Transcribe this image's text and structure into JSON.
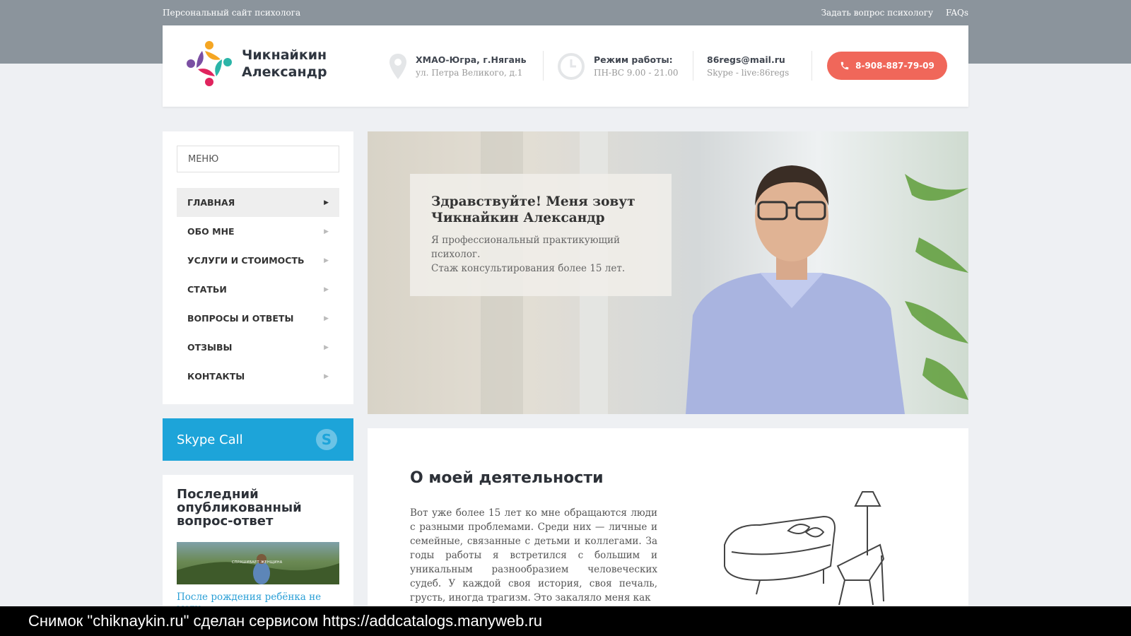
{
  "topbar": {
    "site_tagline": "Персональный сайт психолога",
    "links": [
      "Задать вопрос психологу",
      "FAQs"
    ]
  },
  "header": {
    "logo_line1": "Чикнайкин",
    "logo_line2": "Александр",
    "location": {
      "city": "ХМАО-Югра, г.Нягань",
      "address": "ул. Петра Великого, д.1",
      "icon": "map-pin-icon"
    },
    "hours": {
      "label": "Режим работы:",
      "value": "ПН-ВС 9.00 - 21.00",
      "icon": "clock-icon"
    },
    "contact": {
      "email": "86regs@mail.ru",
      "skype": "Skype - live:86regs"
    },
    "phone": "8-908-887-79-09"
  },
  "sidebar": {
    "menu_placeholder": "МЕНЮ",
    "items": [
      {
        "label": "ГЛАВНАЯ",
        "active": true
      },
      {
        "label": "ОБО МНЕ"
      },
      {
        "label": "УСЛУГИ И СТОИМОСТЬ"
      },
      {
        "label": "СТАТЬИ"
      },
      {
        "label": "ВОПРОСЫ И ОТВЕТЫ"
      },
      {
        "label": "ОТЗЫВЫ"
      },
      {
        "label": "КОНТАКТЫ"
      }
    ],
    "skype_label": "Skype Call",
    "last_qa": {
      "title": "Последний опубликованный вопрос-ответ",
      "image_caption": "СПРАШИВАЕТ ЖЕНЩИНА",
      "link": "После рождения ребёнка не могу"
    }
  },
  "hero": {
    "title": "Здравствуйте! Меня зовут Чикнайкин Александр",
    "line1": "Я профессиональный практикующий психолог.",
    "line2": "Стаж консультирования более 15 лет."
  },
  "content": {
    "heading": "О моей деятельности",
    "paragraph": "Вот уже более 15 лет ко мне обращаются люди с разными проблемами. Среди них — личные и семейные, связанные с детьми и коллегами. За годы работы я встретился с большим и уникальным разнообразием человеческих судеб. У каждой своя история, своя печаль, грусть, иногда трагизм. Это закаляло меня как"
  },
  "screenshot_caption": "Снимок \"chiknaykin.ru\" сделан сервисом https://addcatalogs.manyweb.ru",
  "colors": {
    "accent_phone": "#f0675a",
    "skype_blue": "#1da4d9",
    "link": "#2a9fd6",
    "top_band": "#8b949c"
  }
}
